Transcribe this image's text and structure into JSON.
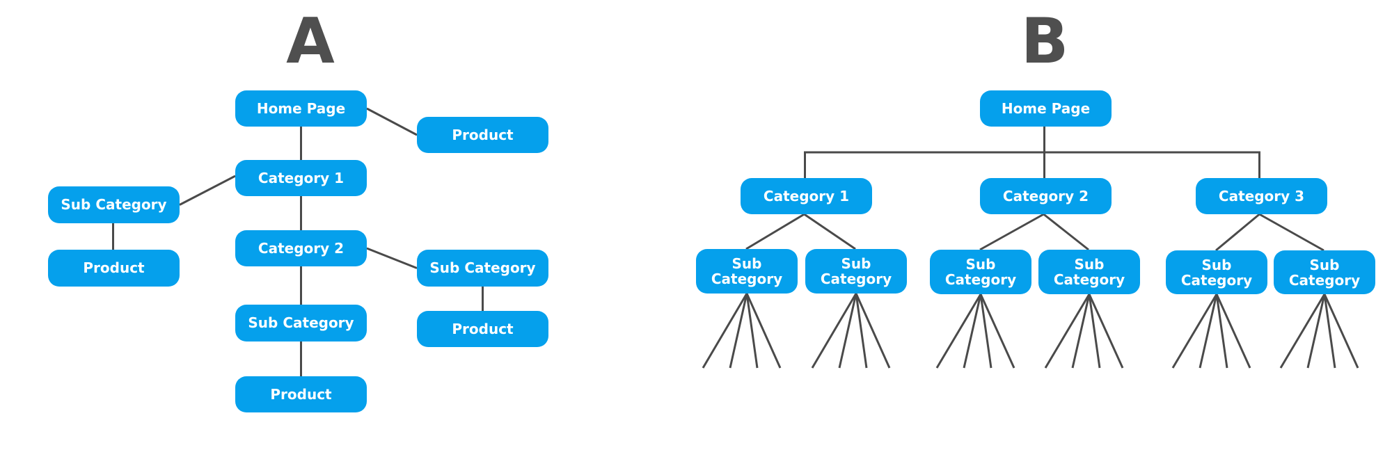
{
  "colors": {
    "node_fill": "#05a0ec",
    "node_text": "#ffffff",
    "line": "#4a4a4a",
    "title": "#4f4f4f"
  },
  "diagram_a": {
    "title": "A",
    "nodes": [
      {
        "id": "a-home",
        "label": "Home Page"
      },
      {
        "id": "a-product-top",
        "label": "Product"
      },
      {
        "id": "a-cat1",
        "label": "Category 1"
      },
      {
        "id": "a-sub-left",
        "label": "Sub Category"
      },
      {
        "id": "a-product-left",
        "label": "Product"
      },
      {
        "id": "a-cat2",
        "label": "Category 2"
      },
      {
        "id": "a-sub-right",
        "label": "Sub Category"
      },
      {
        "id": "a-product-right",
        "label": "Product"
      },
      {
        "id": "a-sub-mid",
        "label": "Sub Category"
      },
      {
        "id": "a-product-bottom",
        "label": "Product"
      }
    ],
    "edges": [
      [
        "a-home",
        "a-product-top"
      ],
      [
        "a-home",
        "a-cat1"
      ],
      [
        "a-cat1",
        "a-sub-left"
      ],
      [
        "a-sub-left",
        "a-product-left"
      ],
      [
        "a-cat1",
        "a-cat2"
      ],
      [
        "a-cat2",
        "a-sub-right"
      ],
      [
        "a-sub-right",
        "a-product-right"
      ],
      [
        "a-cat2",
        "a-sub-mid"
      ],
      [
        "a-sub-mid",
        "a-product-bottom"
      ]
    ]
  },
  "diagram_b": {
    "title": "B",
    "nodes": [
      {
        "id": "b-home",
        "label": "Home Page"
      },
      {
        "id": "b-cat1",
        "label": "Category 1"
      },
      {
        "id": "b-cat2",
        "label": "Category 2"
      },
      {
        "id": "b-cat3",
        "label": "Category 3"
      },
      {
        "id": "b-sub1a",
        "label": "Sub\nCategory"
      },
      {
        "id": "b-sub1b",
        "label": "Sub\nCategory"
      },
      {
        "id": "b-sub2a",
        "label": "Sub\nCategory"
      },
      {
        "id": "b-sub2b",
        "label": "Sub\nCategory"
      },
      {
        "id": "b-sub3a",
        "label": "Sub\nCategory"
      },
      {
        "id": "b-sub3b",
        "label": "Sub\nCategory"
      }
    ],
    "edges": [
      [
        "b-home",
        "b-cat1"
      ],
      [
        "b-home",
        "b-cat2"
      ],
      [
        "b-home",
        "b-cat3"
      ],
      [
        "b-cat1",
        "b-sub1a"
      ],
      [
        "b-cat1",
        "b-sub1b"
      ],
      [
        "b-cat2",
        "b-sub2a"
      ],
      [
        "b-cat2",
        "b-sub2b"
      ],
      [
        "b-cat3",
        "b-sub3a"
      ],
      [
        "b-cat3",
        "b-sub3b"
      ]
    ],
    "leaf_branches_per_subcategory": 4
  }
}
